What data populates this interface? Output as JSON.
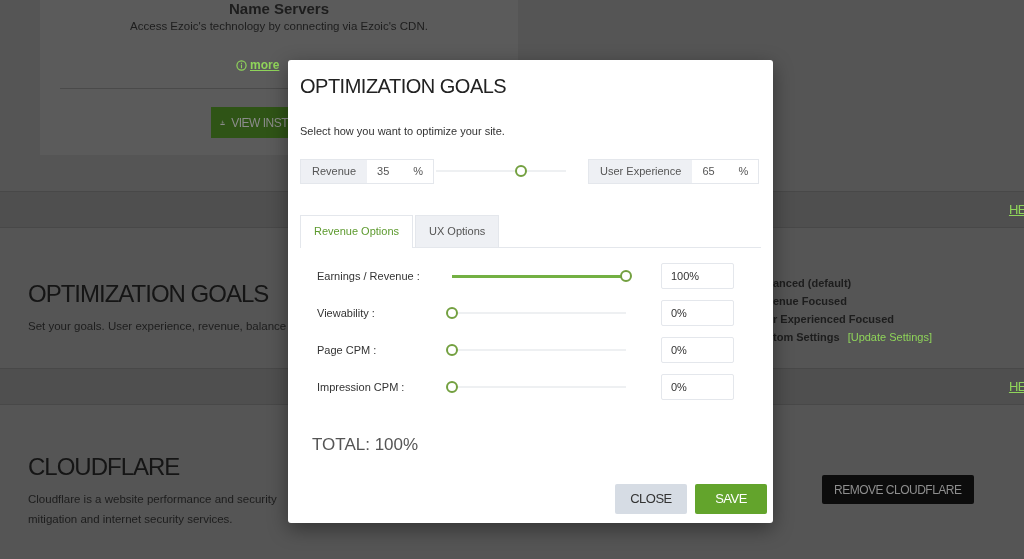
{
  "page": {
    "name_servers": {
      "title": "Name Servers",
      "description": "Access Ezoic's technology by connecting via Ezoic's CDN.",
      "more_link": "more",
      "button": "VIEW INST"
    },
    "help_links": [
      "HE",
      "HE"
    ],
    "optimization_section": {
      "title": "OPTIMIZATION GOALS",
      "description": "Set your goals. User experience, revenue, balance",
      "options": [
        {
          "label": "anced (default)"
        },
        {
          "label": "enue Focused"
        },
        {
          "label": "r Experienced Focused"
        },
        {
          "label": "tom Settings",
          "link": "[Update Settings]"
        }
      ]
    },
    "cloudflare": {
      "title": "CLOUDFLARE",
      "description_lines": [
        "Cloudflare is a website performance and security",
        "mitigation and internet security services."
      ],
      "button": "REMOVE CLOUDFLARE"
    }
  },
  "modal": {
    "title": "OPTIMIZATION GOALS",
    "subtitle": "Select how you want to optimize your site.",
    "balance": {
      "left": {
        "label": "Revenue",
        "value": "35",
        "unit": "%"
      },
      "level": 0.65,
      "right": {
        "label": "User Experience",
        "value": "65",
        "unit": "%"
      }
    },
    "tabs": [
      {
        "label": "Revenue Options",
        "selected": true
      },
      {
        "label": "UX Options",
        "selected": false
      }
    ],
    "sliders": [
      {
        "label": "Earnings / Revenue :",
        "level": 1,
        "value": "100%"
      },
      {
        "label": "Viewability :",
        "level": 0,
        "value": "0%"
      },
      {
        "label": "Page CPM :",
        "level": 0,
        "value": "0%"
      },
      {
        "label": "Impression CPM :",
        "level": 0,
        "value": "0%"
      }
    ],
    "total": "TOTAL: 100%",
    "buttons": [
      {
        "label": "CLOSE",
        "kind": "secondary"
      },
      {
        "label": "SAVE",
        "kind": "primary"
      }
    ]
  }
}
